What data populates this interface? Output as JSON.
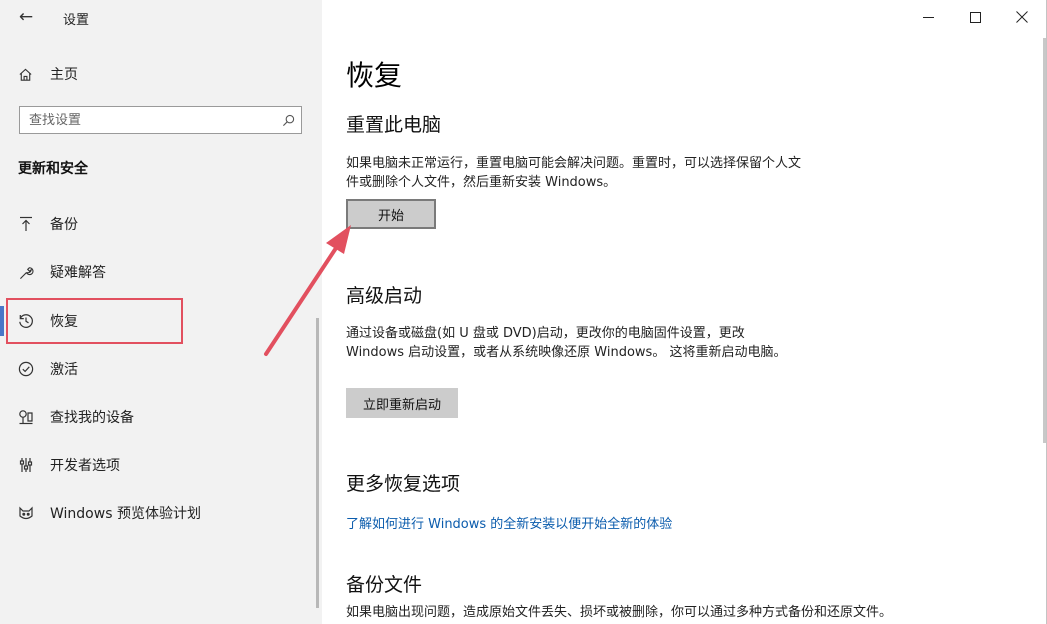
{
  "window": {
    "title": "设置",
    "back_icon": "←",
    "minimize_icon": "minimize-icon",
    "maximize_icon": "maximize-icon",
    "close_icon": "close-icon"
  },
  "sidebar": {
    "home_label": "主页",
    "search_placeholder": "查找设置",
    "section_title": "更新和安全",
    "items": [
      {
        "label": "备份",
        "icon": "backup-icon"
      },
      {
        "label": "疑难解答",
        "icon": "wrench-icon"
      },
      {
        "label": "恢复",
        "icon": "history-icon",
        "active": true
      },
      {
        "label": "激活",
        "icon": "check-circle-icon"
      },
      {
        "label": "查找我的设备",
        "icon": "find-device-icon"
      },
      {
        "label": "开发者选项",
        "icon": "developer-icon"
      },
      {
        "label": "Windows 预览体验计划",
        "icon": "insider-icon"
      }
    ]
  },
  "main": {
    "title": "恢复",
    "reset": {
      "heading": "重置此电脑",
      "description": "如果电脑未正常运行，重置电脑可能会解决问题。重置时，可以选择保留个人文件或删除个人文件，然后重新安装 Windows。",
      "button": "开始"
    },
    "advanced": {
      "heading": "高级启动",
      "description": "通过设备或磁盘(如 U 盘或 DVD)启动，更改你的电脑固件设置，更改 Windows 启动设置，或者从系统映像还原 Windows。 这将重新启动电脑。",
      "button": "立即重新启动"
    },
    "more": {
      "heading": "更多恢复选项",
      "link": "了解如何进行 Windows 的全新安装以便开始全新的体验"
    },
    "backup": {
      "heading": "备份文件",
      "description": "如果电脑出现问题，造成原始文件丢失、损坏或被删除，你可以通过多种方式备份和还原文件。"
    }
  },
  "colors": {
    "sidebar_bg": "#f2f2f2",
    "accent": "#4a76c8",
    "link": "#0b5cad",
    "annotation_red": "#e2505f",
    "button_bg": "#cccccc"
  }
}
